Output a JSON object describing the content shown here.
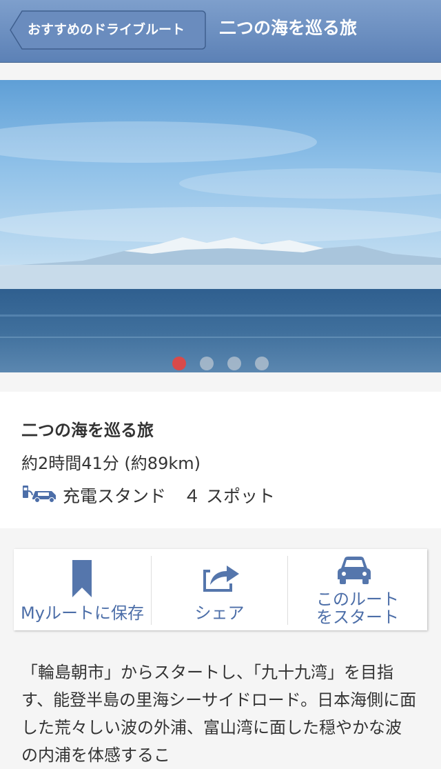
{
  "navbar": {
    "back_label": "おすすめのドライブルート",
    "title": "二つの海を巡る旅"
  },
  "hero": {
    "image_description_icon": "photo",
    "page_count": 4,
    "active_page": 1,
    "active_color": "#d84a4a",
    "inactive_color": "#b9c6d2"
  },
  "route": {
    "name": "二つの海を巡る旅",
    "meta": "約2時間41分 (約89km)",
    "ev_icon": "ev-charger-car-icon",
    "ev_label": "充電スタンド　４ スポット"
  },
  "actions": [
    {
      "icon": "bookmark-icon",
      "label": "Myルートに保存"
    },
    {
      "icon": "share-icon",
      "label": "シェア"
    },
    {
      "icon": "car-icon",
      "label_line1": "このルート",
      "label_line2": "をスタート"
    }
  ],
  "description": "「輪島朝市」からスタートし、「九十九湾」を目指す、能登半島の里海シーサイドロード。日本海側に面した荒々しい波の外浦、富山湾に面した穏やかな波の内浦を体感するこ",
  "colors": {
    "accent": "#4c6ea8",
    "navbar_top": "#7e9fcc",
    "navbar_bottom": "#5c81b6"
  }
}
